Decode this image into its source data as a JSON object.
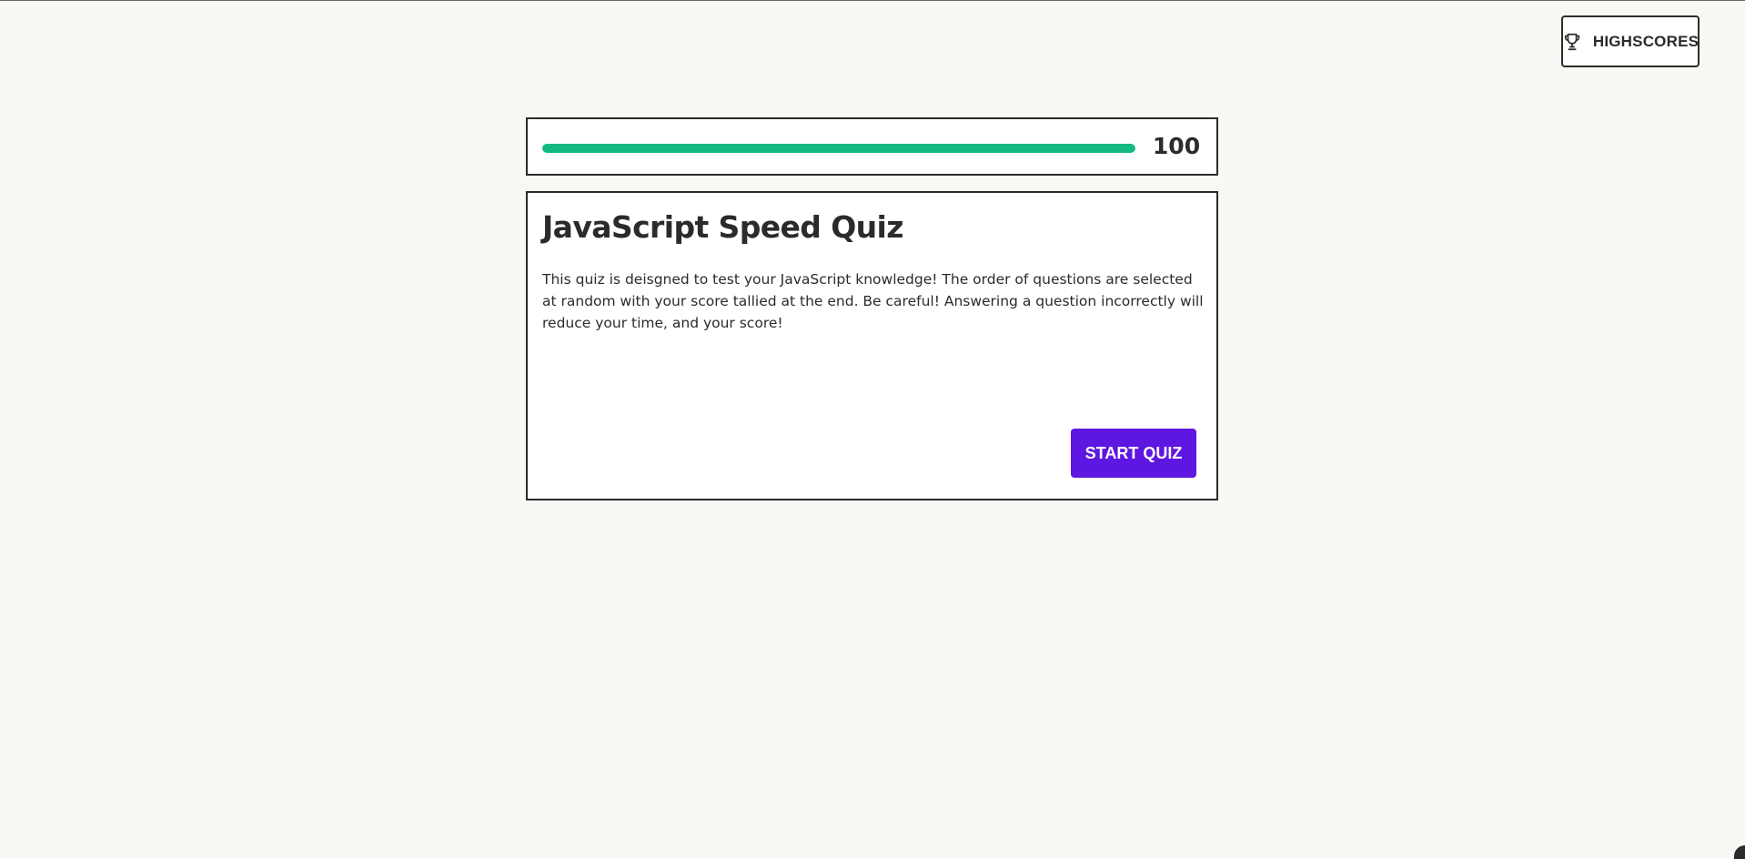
{
  "header": {
    "highscores_label": "HIGHSCORES",
    "highscores_icon": "trophy-icon"
  },
  "timer": {
    "value": "100",
    "progress_fraction": 1.0,
    "bar_color": "#13b883"
  },
  "quiz": {
    "title": "JavaScript Speed Quiz",
    "description": "This quiz is deisgned to test your JavaScript knowledge! The order of questions are selected at random with your score tallied at the end. Be careful! Answering a question incorrectly will reduce your time, and your score!",
    "start_label": "START QUIZ"
  },
  "colors": {
    "background": "#f9f8f4",
    "accent": "#5e17e0",
    "border": "#2b2b2b"
  }
}
